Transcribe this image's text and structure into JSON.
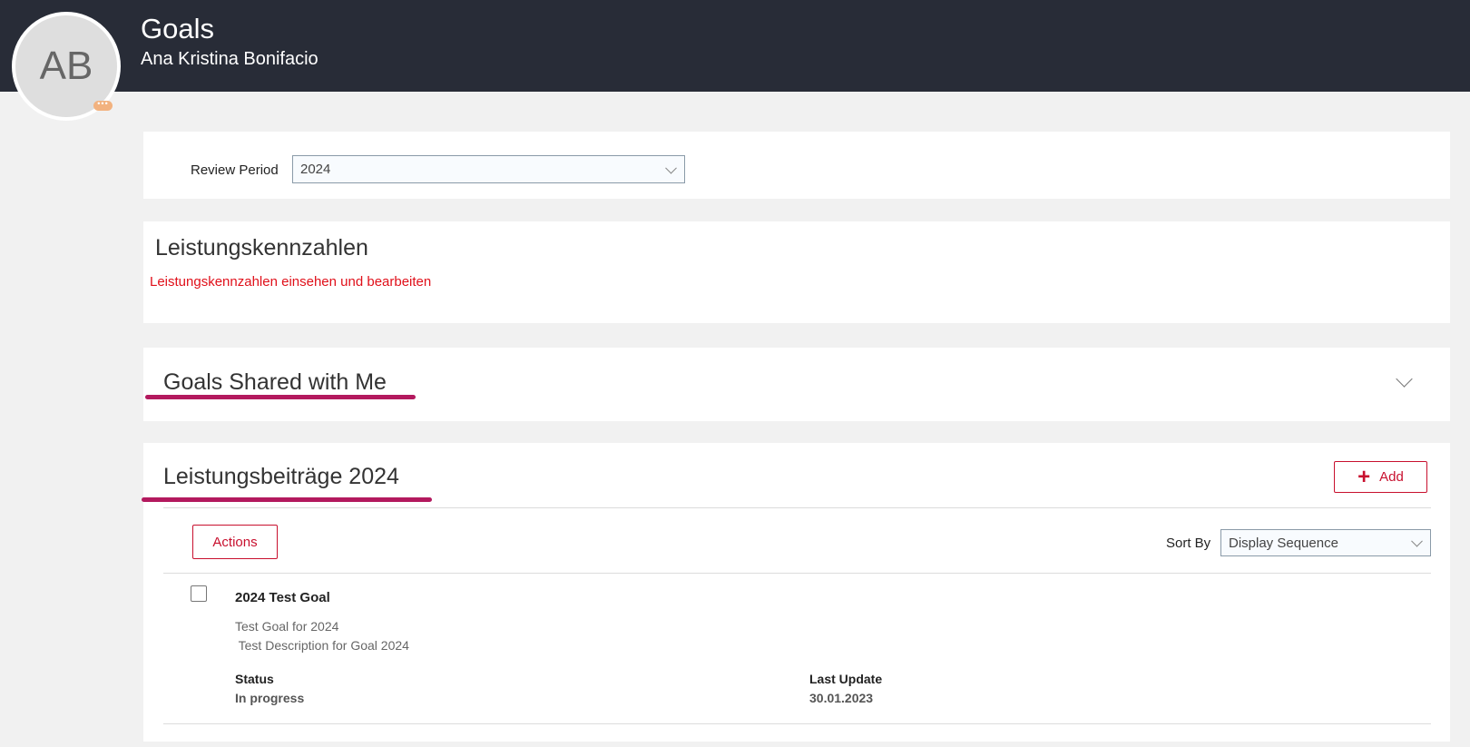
{
  "header": {
    "title": "Goals",
    "subtitle": "Ana Kristina Bonifacio",
    "avatar_initials": "AB",
    "avatar_badge": "•••"
  },
  "review": {
    "label": "Review Period",
    "value": "2024"
  },
  "kpi": {
    "title": "Leistungskennzahlen",
    "link": "Leistungskennzahlen einsehen und bearbeiten"
  },
  "shared": {
    "title": "Goals Shared with Me"
  },
  "contrib": {
    "title": "Leistungsbeiträge 2024",
    "add_label": "Add",
    "actions_label": "Actions",
    "sort_label": "Sort By",
    "sort_value": "Display Sequence",
    "goals": [
      {
        "name": "2024 Test Goal",
        "line1": "Test Goal for 2024",
        "line2": " Test Description for Goal 2024",
        "status_label": "Status",
        "status": "In progress",
        "update_label": "Last Update",
        "update": "30.01.2023"
      }
    ]
  },
  "colors": {
    "header": "#282c37",
    "accent": "#c8102e",
    "underline": "#b3195e"
  }
}
